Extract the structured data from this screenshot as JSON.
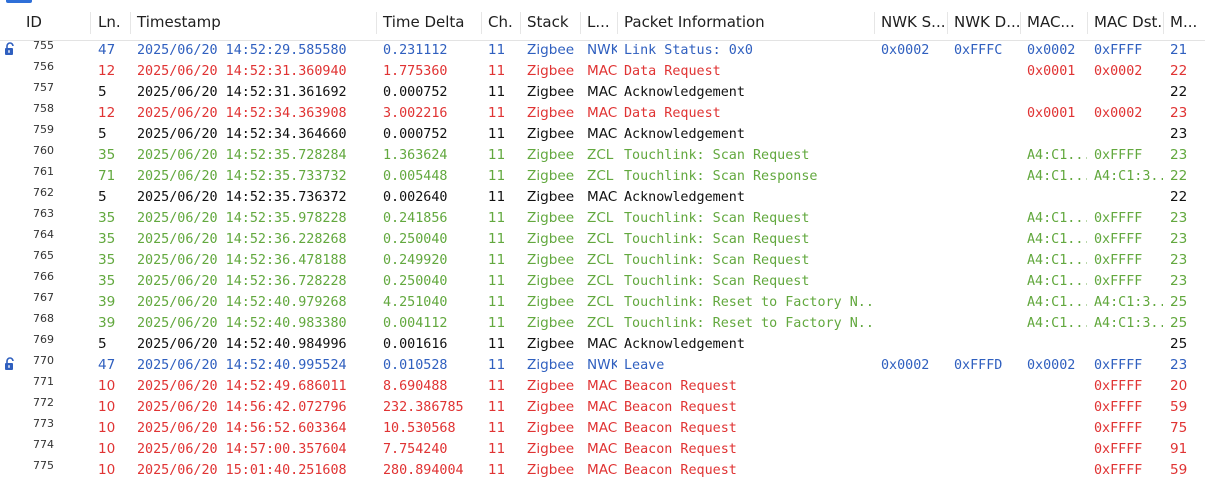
{
  "colors": {
    "blue": "#2f5fbf",
    "red": "#e03333",
    "green": "#62a83e",
    "black": "#111111"
  },
  "headers": [
    "ID",
    "Ln.",
    "Timestamp",
    "Time Delta",
    "Ch.",
    "Stack",
    "L...",
    "Packet Information",
    "NWK S...",
    "NWK D...",
    "MAC...",
    "MAC Dst.",
    "M..."
  ],
  "rows": [
    {
      "id": "755",
      "ln": "47",
      "ts": "2025/06/20 14:52:29.585580",
      "delta": "0.231112",
      "ch": "11",
      "stack": "Zigbee",
      "layer": "NWK",
      "info": "Link Status: 0x0",
      "nwks": "0x0002",
      "nwkd": "0xFFFC",
      "macs": "0x0002",
      "macd": "0xFFFF",
      "m": "21",
      "color": "blue",
      "lock": true
    },
    {
      "id": "756",
      "ln": "12",
      "ts": "2025/06/20 14:52:31.360940",
      "delta": "1.775360",
      "ch": "11",
      "stack": "Zigbee",
      "layer": "MAC",
      "info": "Data Request",
      "nwks": "",
      "nwkd": "",
      "macs": "0x0001",
      "macd": "0x0002",
      "m": "22",
      "color": "red",
      "lock": false
    },
    {
      "id": "757",
      "ln": "5",
      "ts": "2025/06/20 14:52:31.361692",
      "delta": "0.000752",
      "ch": "11",
      "stack": "Zigbee",
      "layer": "MAC",
      "info": "Acknowledgement",
      "nwks": "",
      "nwkd": "",
      "macs": "",
      "macd": "",
      "m": "22",
      "color": "black",
      "lock": false
    },
    {
      "id": "758",
      "ln": "12",
      "ts": "2025/06/20 14:52:34.363908",
      "delta": "3.002216",
      "ch": "11",
      "stack": "Zigbee",
      "layer": "MAC",
      "info": "Data Request",
      "nwks": "",
      "nwkd": "",
      "macs": "0x0001",
      "macd": "0x0002",
      "m": "23",
      "color": "red",
      "lock": false
    },
    {
      "id": "759",
      "ln": "5",
      "ts": "2025/06/20 14:52:34.364660",
      "delta": "0.000752",
      "ch": "11",
      "stack": "Zigbee",
      "layer": "MAC",
      "info": "Acknowledgement",
      "nwks": "",
      "nwkd": "",
      "macs": "",
      "macd": "",
      "m": "23",
      "color": "black",
      "lock": false
    },
    {
      "id": "760",
      "ln": "35",
      "ts": "2025/06/20 14:52:35.728284",
      "delta": "1.363624",
      "ch": "11",
      "stack": "Zigbee",
      "layer": "ZCL",
      "info": "Touchlink: Scan Request",
      "nwks": "",
      "nwkd": "",
      "macs": "A4:C1...",
      "macd": "0xFFFF",
      "m": "23",
      "color": "green",
      "lock": false
    },
    {
      "id": "761",
      "ln": "71",
      "ts": "2025/06/20 14:52:35.733732",
      "delta": "0.005448",
      "ch": "11",
      "stack": "Zigbee",
      "layer": "ZCL",
      "info": "Touchlink: Scan Response",
      "nwks": "",
      "nwkd": "",
      "macs": "A4:C1...",
      "macd": "A4:C1:3...",
      "m": "22",
      "color": "green",
      "lock": false
    },
    {
      "id": "762",
      "ln": "5",
      "ts": "2025/06/20 14:52:35.736372",
      "delta": "0.002640",
      "ch": "11",
      "stack": "Zigbee",
      "layer": "MAC",
      "info": "Acknowledgement",
      "nwks": "",
      "nwkd": "",
      "macs": "",
      "macd": "",
      "m": "22",
      "color": "black",
      "lock": false
    },
    {
      "id": "763",
      "ln": "35",
      "ts": "2025/06/20 14:52:35.978228",
      "delta": "0.241856",
      "ch": "11",
      "stack": "Zigbee",
      "layer": "ZCL",
      "info": "Touchlink: Scan Request",
      "nwks": "",
      "nwkd": "",
      "macs": "A4:C1...",
      "macd": "0xFFFF",
      "m": "23",
      "color": "green",
      "lock": false
    },
    {
      "id": "764",
      "ln": "35",
      "ts": "2025/06/20 14:52:36.228268",
      "delta": "0.250040",
      "ch": "11",
      "stack": "Zigbee",
      "layer": "ZCL",
      "info": "Touchlink: Scan Request",
      "nwks": "",
      "nwkd": "",
      "macs": "A4:C1...",
      "macd": "0xFFFF",
      "m": "23",
      "color": "green",
      "lock": false
    },
    {
      "id": "765",
      "ln": "35",
      "ts": "2025/06/20 14:52:36.478188",
      "delta": "0.249920",
      "ch": "11",
      "stack": "Zigbee",
      "layer": "ZCL",
      "info": "Touchlink: Scan Request",
      "nwks": "",
      "nwkd": "",
      "macs": "A4:C1...",
      "macd": "0xFFFF",
      "m": "23",
      "color": "green",
      "lock": false
    },
    {
      "id": "766",
      "ln": "35",
      "ts": "2025/06/20 14:52:36.728228",
      "delta": "0.250040",
      "ch": "11",
      "stack": "Zigbee",
      "layer": "ZCL",
      "info": "Touchlink: Scan Request",
      "nwks": "",
      "nwkd": "",
      "macs": "A4:C1...",
      "macd": "0xFFFF",
      "m": "23",
      "color": "green",
      "lock": false
    },
    {
      "id": "767",
      "ln": "39",
      "ts": "2025/06/20 14:52:40.979268",
      "delta": "4.251040",
      "ch": "11",
      "stack": "Zigbee",
      "layer": "ZCL",
      "info": "Touchlink: Reset to Factory N...",
      "nwks": "",
      "nwkd": "",
      "macs": "A4:C1...",
      "macd": "A4:C1:3...",
      "m": "25",
      "color": "green",
      "lock": false
    },
    {
      "id": "768",
      "ln": "39",
      "ts": "2025/06/20 14:52:40.983380",
      "delta": "0.004112",
      "ch": "11",
      "stack": "Zigbee",
      "layer": "ZCL",
      "info": "Touchlink: Reset to Factory N...",
      "nwks": "",
      "nwkd": "",
      "macs": "A4:C1...",
      "macd": "A4:C1:3...",
      "m": "25",
      "color": "green",
      "lock": false
    },
    {
      "id": "769",
      "ln": "5",
      "ts": "2025/06/20 14:52:40.984996",
      "delta": "0.001616",
      "ch": "11",
      "stack": "Zigbee",
      "layer": "MAC",
      "info": "Acknowledgement",
      "nwks": "",
      "nwkd": "",
      "macs": "",
      "macd": "",
      "m": "25",
      "color": "black",
      "lock": false
    },
    {
      "id": "770",
      "ln": "47",
      "ts": "2025/06/20 14:52:40.995524",
      "delta": "0.010528",
      "ch": "11",
      "stack": "Zigbee",
      "layer": "NWK",
      "info": "Leave",
      "nwks": "0x0002",
      "nwkd": "0xFFFD",
      "macs": "0x0002",
      "macd": "0xFFFF",
      "m": "23",
      "color": "blue",
      "lock": true
    },
    {
      "id": "771",
      "ln": "10",
      "ts": "2025/06/20 14:52:49.686011",
      "delta": "8.690488",
      "ch": "11",
      "stack": "Zigbee",
      "layer": "MAC",
      "info": "Beacon Request",
      "nwks": "",
      "nwkd": "",
      "macs": "",
      "macd": "0xFFFF",
      "m": "20",
      "color": "red",
      "lock": false
    },
    {
      "id": "772",
      "ln": "10",
      "ts": "2025/06/20 14:56:42.072796",
      "delta": "232.386785",
      "ch": "11",
      "stack": "Zigbee",
      "layer": "MAC",
      "info": "Beacon Request",
      "nwks": "",
      "nwkd": "",
      "macs": "",
      "macd": "0xFFFF",
      "m": "59",
      "color": "red",
      "lock": false
    },
    {
      "id": "773",
      "ln": "10",
      "ts": "2025/06/20 14:56:52.603364",
      "delta": "10.530568",
      "ch": "11",
      "stack": "Zigbee",
      "layer": "MAC",
      "info": "Beacon Request",
      "nwks": "",
      "nwkd": "",
      "macs": "",
      "macd": "0xFFFF",
      "m": "75",
      "color": "red",
      "lock": false
    },
    {
      "id": "774",
      "ln": "10",
      "ts": "2025/06/20 14:57:00.357604",
      "delta": "7.754240",
      "ch": "11",
      "stack": "Zigbee",
      "layer": "MAC",
      "info": "Beacon Request",
      "nwks": "",
      "nwkd": "",
      "macs": "",
      "macd": "0xFFFF",
      "m": "91",
      "color": "red",
      "lock": false
    },
    {
      "id": "775",
      "ln": "10",
      "ts": "2025/06/20 15:01:40.251608",
      "delta": "280.894004",
      "ch": "11",
      "stack": "Zigbee",
      "layer": "MAC",
      "info": "Beacon Request",
      "nwks": "",
      "nwkd": "",
      "macs": "",
      "macd": "0xFFFF",
      "m": "59",
      "color": "red",
      "lock": false
    }
  ]
}
